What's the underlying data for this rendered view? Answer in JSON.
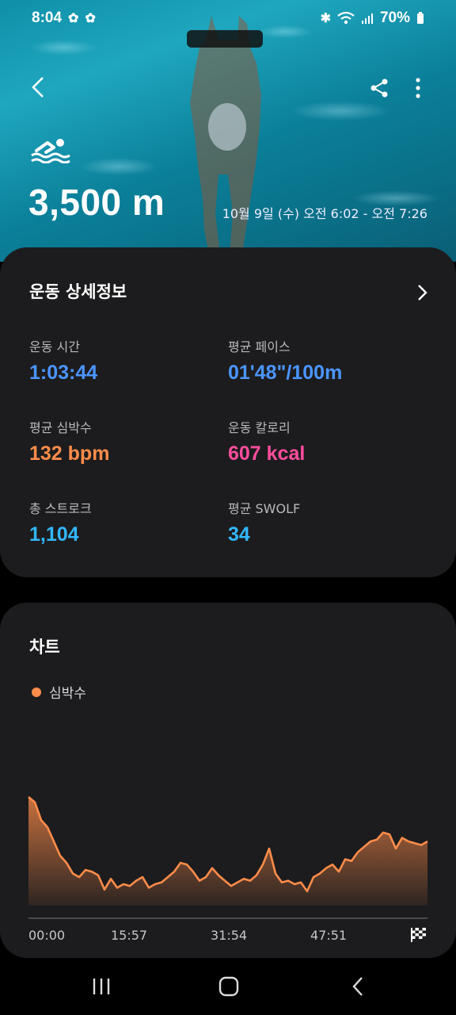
{
  "status_bar": {
    "time": "8:04",
    "battery": "70%"
  },
  "header": {
    "distance": "3,500 m",
    "date_range": "10월 9일 (수) 오전 6:02 - 오전 7:26"
  },
  "details": {
    "title": "운동 상세정보",
    "metrics": [
      {
        "label": "운동 시간",
        "value": "1:03:44",
        "color": "#4b95ff"
      },
      {
        "label": "평균 페이스",
        "value": "01'48\"/100m",
        "color": "#4b95ff"
      },
      {
        "label": "평균 심박수",
        "value": "132 bpm",
        "color": "#ff8c4a"
      },
      {
        "label": "운동 칼로리",
        "value": "607 kcal",
        "color": "#ff4d9e"
      },
      {
        "label": "총 스트로크",
        "value": "1,104",
        "color": "#32b8ff"
      },
      {
        "label": "평균 SWOLF",
        "value": "34",
        "color": "#32b8ff"
      }
    ]
  },
  "chart_card": {
    "title": "차트",
    "legend": "심박수",
    "ticks": [
      "00:00",
      "15:57",
      "31:54",
      "47:51"
    ]
  },
  "chart_data": {
    "type": "area",
    "series": [
      {
        "name": "심박수",
        "color": "#ff8c4a",
        "x": [
          0,
          1,
          2,
          3,
          4,
          5,
          6,
          7,
          8,
          9,
          10,
          11,
          12,
          13,
          14,
          15,
          16,
          17,
          18,
          19,
          20,
          21,
          22,
          23,
          24,
          25,
          26,
          27,
          28,
          29,
          30,
          31,
          32,
          33,
          34,
          35,
          36,
          37,
          38,
          39,
          40,
          41,
          42,
          43,
          44,
          45,
          46,
          47,
          48,
          49,
          50,
          51,
          52,
          53,
          54,
          55,
          56,
          57,
          58,
          59,
          60,
          61,
          62,
          63
        ],
        "values": [
          161,
          158,
          148,
          144,
          136,
          128,
          124,
          118,
          116,
          120,
          119,
          117,
          109,
          115,
          110,
          112,
          111,
          114,
          116,
          110,
          112,
          113,
          116,
          119,
          124,
          123,
          119,
          114,
          116,
          121,
          117,
          114,
          111,
          113,
          115,
          114,
          117,
          123,
          132,
          118,
          113,
          114,
          112,
          113,
          108,
          116,
          118,
          121,
          123,
          119,
          126,
          125,
          130,
          133,
          136,
          137,
          141,
          140,
          132,
          138,
          136,
          135,
          134,
          136
        ]
      }
    ]
  },
  "nav": {
    "recents": "recents",
    "home": "home",
    "back": "back"
  }
}
